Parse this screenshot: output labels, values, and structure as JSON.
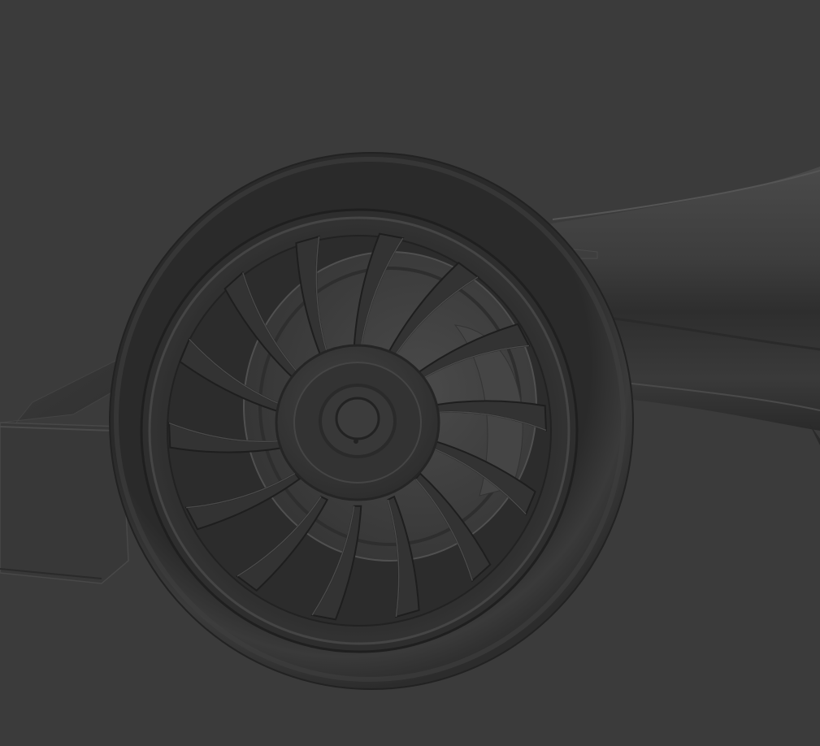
{
  "scene": {
    "background_color": "#3b3b3b",
    "model_color": "#3a3a3a",
    "spoke_count": 14,
    "objects": [
      "front-wing-endplate",
      "front-wing-flap",
      "suspension-wishbone",
      "sidepod-body",
      "tyre",
      "rim-lip",
      "brake-drum",
      "wheel-spokes",
      "wheel-hub",
      "centre-nut"
    ]
  }
}
